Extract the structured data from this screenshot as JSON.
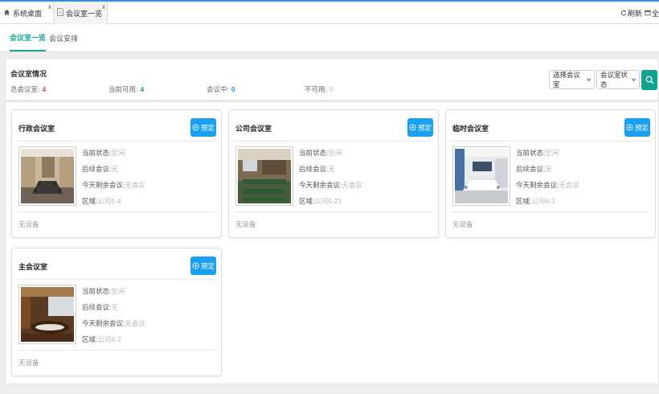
{
  "top_tabs": [
    {
      "label": "系统桌面",
      "icon": "home-icon"
    },
    {
      "label": "会议室一览",
      "icon": "document-icon"
    }
  ],
  "top_actions": {
    "refresh": "刷新",
    "fullscreen": "全"
  },
  "sub_tabs": [
    "会议室一览",
    "会议安排"
  ],
  "summary": {
    "title": "会议室情况",
    "stats": [
      {
        "label": "总会议室:",
        "value": "4",
        "color": "#e23c3c"
      },
      {
        "label": "当前可用:",
        "value": "4",
        "color": "#2a9a3a"
      },
      {
        "label": "会议中:",
        "value": "0",
        "color": "#2a8fd8"
      },
      {
        "label": "不可用:",
        "value": "0",
        "color": "#bbbbbb"
      }
    ],
    "filters": {
      "room": "选择会议室",
      "status": "会议室状态"
    }
  },
  "labels": {
    "status": "当前状态:",
    "next": "后续会议:",
    "remaining": "今天剩余会议:",
    "area": "区域:",
    "book": "预定"
  },
  "rooms": [
    {
      "name": "行政会议室",
      "status": "空闲",
      "next": "无",
      "remaining": "无会议",
      "area": "公司5-4",
      "equipment": "无设备"
    },
    {
      "name": "公司会议室",
      "status": "空闲",
      "next": "无",
      "remaining": "无会议",
      "area": "公司5-21",
      "equipment": "无设备"
    },
    {
      "name": "临时会议室",
      "status": "空闲",
      "next": "无",
      "remaining": "无会议",
      "area": "公司6-3",
      "equipment": "无设备"
    },
    {
      "name": "主会议室",
      "status": "空闲",
      "next": "无",
      "remaining": "无会议",
      "area": "公司6-2",
      "equipment": "无设备"
    }
  ]
}
